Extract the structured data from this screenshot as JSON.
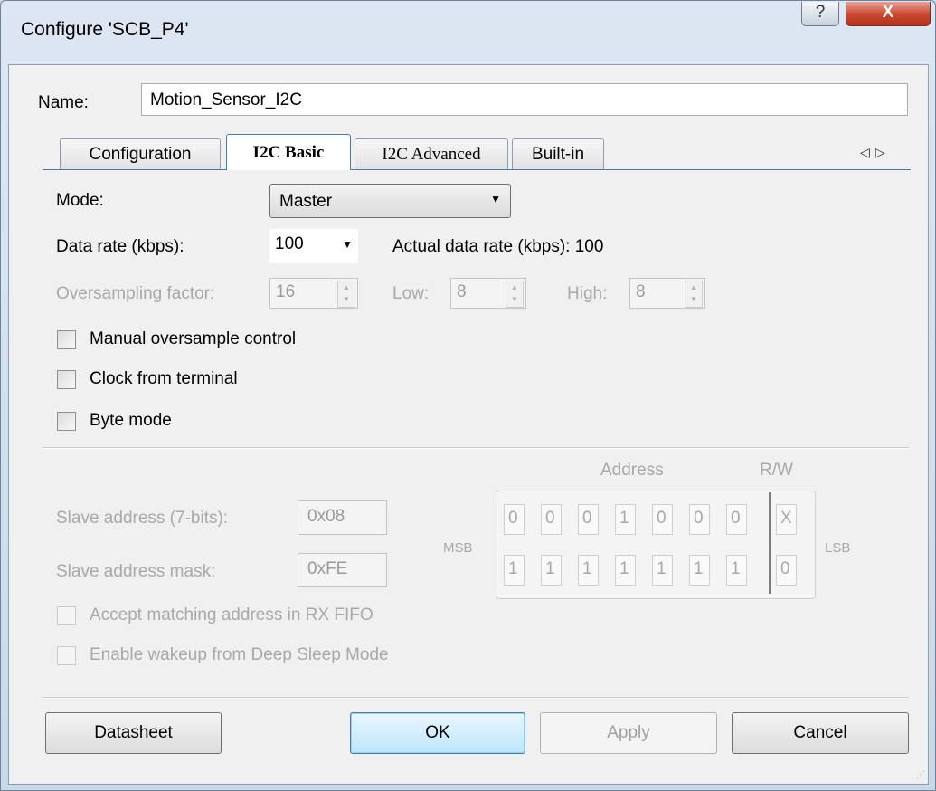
{
  "window": {
    "title": "Configure 'SCB_P4'",
    "help_glyph": "?",
    "close_glyph": "X"
  },
  "name": {
    "label": "Name:",
    "value": "Motion_Sensor_I2C"
  },
  "tabs": [
    {
      "label": "Configuration",
      "active": false
    },
    {
      "label": "I2C Basic",
      "active": true
    },
    {
      "label": "I2C Advanced",
      "active": false
    },
    {
      "label": "Built-in",
      "active": false
    }
  ],
  "tab_nav": {
    "left": "◁",
    "right": "▷"
  },
  "mode": {
    "label": "Mode:",
    "value": "Master",
    "arrow": "▼"
  },
  "data_rate": {
    "label": "Data rate (kbps):",
    "value": "100",
    "arrow": "▼",
    "actual_label": "Actual data rate (kbps): 100"
  },
  "oversampling": {
    "label": "Oversampling factor:",
    "factor": "16",
    "low_label": "Low:",
    "low": "8",
    "high_label": "High:",
    "high": "8"
  },
  "checkboxes": {
    "manual_oversample": {
      "label": "Manual oversample control",
      "checked": false
    },
    "clock_from_terminal": {
      "label": "Clock from terminal",
      "checked": false
    },
    "byte_mode": {
      "label": "Byte mode",
      "checked": false
    }
  },
  "address": {
    "header_address": "Address",
    "header_rw": "R/W",
    "msb_label": "MSB",
    "lsb_label": "LSB",
    "slave_address_label": "Slave address (7-bits):",
    "slave_address": "0x08",
    "slave_mask_label": "Slave address mask:",
    "slave_mask": "0xFE",
    "address_bits": [
      "0",
      "0",
      "0",
      "1",
      "0",
      "0",
      "0"
    ],
    "address_rw": "X",
    "mask_bits": [
      "1",
      "1",
      "1",
      "1",
      "1",
      "1",
      "1"
    ],
    "mask_rw": "0"
  },
  "disabled_checkboxes": {
    "accept_matching": {
      "label": "Accept matching address in RX FIFO",
      "checked": false
    },
    "enable_wakeup": {
      "label": "Enable wakeup from Deep Sleep Mode",
      "checked": false
    }
  },
  "buttons": {
    "datasheet": "Datasheet",
    "ok": "OK",
    "apply": "Apply",
    "cancel": "Cancel"
  },
  "colors": {
    "accent": "#3c7fb1",
    "disabled_text": "#a8a8a8",
    "close_button": "#c9462f"
  }
}
